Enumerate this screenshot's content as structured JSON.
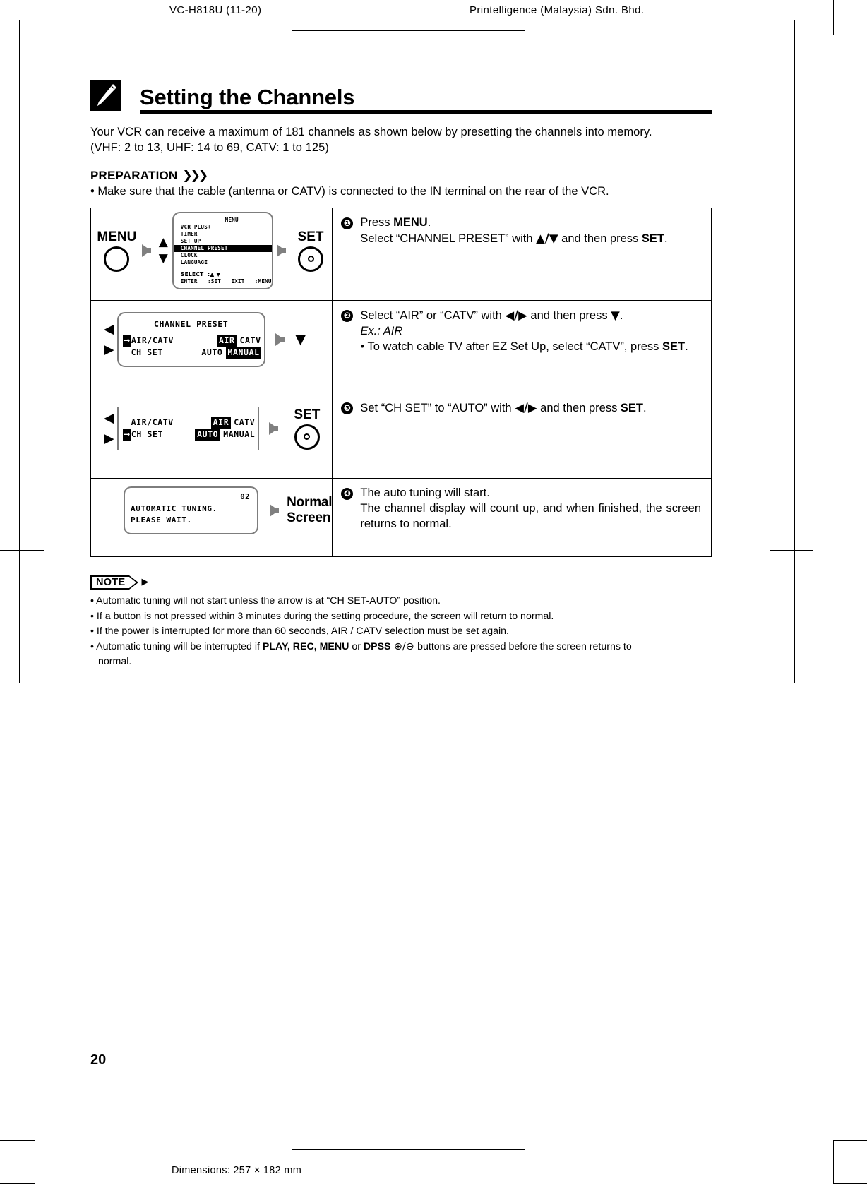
{
  "header": {
    "left": "VC-H818U (11-20)",
    "right": "Printelligence (Malaysia) Sdn. Bhd."
  },
  "page": {
    "title": "Setting the Channels",
    "intro_line1": "Your VCR can receive a maximum of 181 channels as shown below by presetting the channels into memory.",
    "intro_line2": "(VHF: 2 to 13, UHF: 14 to 69, CATV: 1 to 125)",
    "preparation_label": "PREPARATION",
    "preparation_arrows": "❯❯❯",
    "preparation_text": "• Make sure that the cable (antenna or CATV) is connected to the IN terminal on the rear of the VCR.",
    "number": "20",
    "footer": "Dimensions: 257 × 182 mm"
  },
  "steps": [
    {
      "num": "❶",
      "line1_a": "Press ",
      "line1_b": "MENU",
      "line1_c": ".",
      "line2_a": "Select “CHANNEL PRESET” with ",
      "line2_ud": "▲/▼",
      "line2_b": " and then press ",
      "line2_c": "SET",
      "line2_d": "."
    },
    {
      "num": "❷",
      "line1_a": "Select “AIR” or “CATV” with ",
      "line1_lr": "◀/▶",
      "line1_b": " and then press ",
      "line1_dn": "▼",
      "line1_c": ".",
      "line2": "Ex.: AIR",
      "line3_a": "• To watch cable TV after EZ Set Up, select “CATV”, press ",
      "line3_b": "SET",
      "line3_c": "."
    },
    {
      "num": "❸",
      "line1_a": "Set “CH SET” to “AUTO” with ",
      "line1_lr": "◀/▶",
      "line1_b": " and then press ",
      "line1_c": "SET",
      "line1_d": "."
    },
    {
      "num": "❹",
      "line1": "The auto tuning will start.",
      "line2": "The channel display will count up, and when finished, the screen returns to normal."
    }
  ],
  "figures": {
    "menu_button_label": "MENU",
    "set_button_label": "SET",
    "up_arrow": "▲",
    "down_arrow": "▼",
    "left_arrow": "◀",
    "right_arrow": "▶",
    "osd_menu": {
      "title": "MENU",
      "items": [
        "VCR PLUS+",
        "TIMER",
        "SET UP",
        "CHANNEL PRESET",
        "CLOCK",
        "LANGUAGE"
      ],
      "highlighted": "CHANNEL PRESET",
      "hint1": "SELECT  :▲ ▼",
      "hint2": "ENTER   :SET   EXIT   :MENU"
    },
    "osd_preset_step2": {
      "title": "CHANNEL PRESET",
      "cursor": "→",
      "row1_label": "AIR/CATV",
      "row1_opt1": "AIR",
      "row1_opt2": "CATV",
      "row1_selected": "AIR",
      "row2_label": "CH SET",
      "row2_opt1": "AUTO",
      "row2_opt2": "MANUAL",
      "row2_selected": "MANUAL",
      "cursor_on": "AIR/CATV"
    },
    "osd_preset_step3": {
      "cursor": "→",
      "row1_label": "AIR/CATV",
      "row1_opt1": "AIR",
      "row1_opt2": "CATV",
      "row1_selected": "AIR",
      "row2_label": "CH SET",
      "row2_opt1": "AUTO",
      "row2_opt2": "MANUAL",
      "row2_selected": "AUTO",
      "cursor_on": "CH SET"
    },
    "osd_tuning": {
      "count": "02",
      "line1": "AUTOMATIC TUNING.",
      "line2": "PLEASE WAIT."
    },
    "normal_screen_line1": "Normal",
    "normal_screen_line2": "Screen"
  },
  "note": {
    "tag": "NOTE",
    "items": [
      {
        "text": "• Automatic tuning will not start unless the arrow is at “CH SET-AUTO” position."
      },
      {
        "text": "• If a button is not pressed within 3 minutes during the setting procedure, the screen will return to normal."
      },
      {
        "text": "• If the power is interrupted for more than 60 seconds, AIR / CATV selection must be set again."
      }
    ],
    "item4_a": "• Automatic tuning will be interrupted if ",
    "item4_b": "PLAY, REC, MENU",
    "item4_c": " or ",
    "item4_d": "DPSS",
    "item4_sym": " ⊕/⊖ ",
    "item4_e": "buttons are pressed before the screen returns to",
    "item4_f": "normal."
  }
}
